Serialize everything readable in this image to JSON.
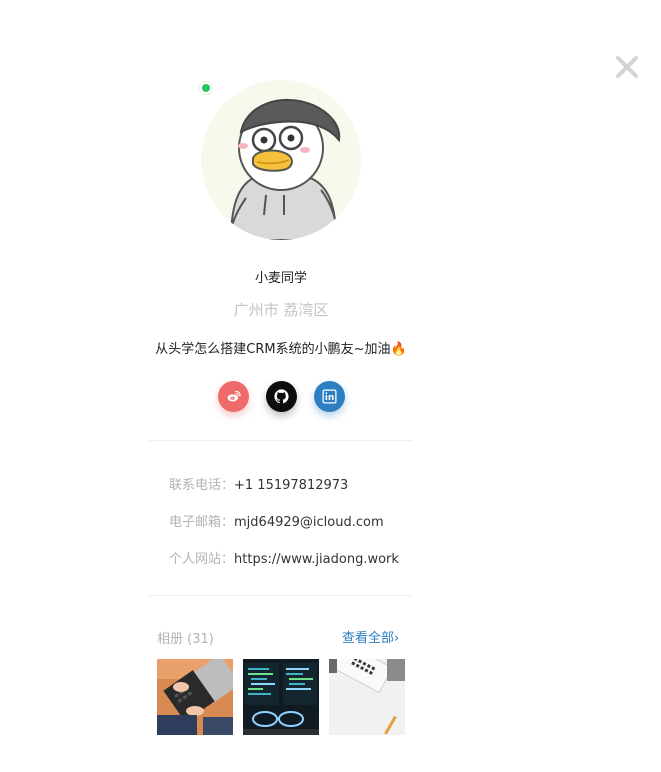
{
  "profile": {
    "name": "小麦同学",
    "location": "广州市 荔湾区",
    "bio": "从头学怎么搭建CRM系统的小鹏友~加油",
    "bio_emoji": "🔥",
    "online_status": "online",
    "avatar_icon": "duck-hoodie-avatar"
  },
  "socials": [
    {
      "name": "weibo",
      "icon": "weibo-icon",
      "color": "#ef6b6b"
    },
    {
      "name": "github",
      "icon": "github-icon",
      "color": "#0d0d0d"
    },
    {
      "name": "linkedin",
      "icon": "linkedin-icon",
      "color": "#2d7fc1"
    }
  ],
  "contact": {
    "phone_label": "联系电话：",
    "phone": "+1 15197812973",
    "email_label": "电子邮箱：",
    "email": "mjd64929@icloud.com",
    "website_label": "个人网站：",
    "website": "https://www.jiadong.work"
  },
  "album": {
    "title": "相册 (31)",
    "view_all": "查看全部",
    "photos": [
      {
        "icon": "laptop-keyboard-photo"
      },
      {
        "icon": "code-monitor-photo"
      },
      {
        "icon": "white-keyboard-photo"
      }
    ]
  },
  "colors": {
    "accent": "#2d7fc1",
    "online": "#22c55e",
    "muted_text": "#b3b3b3"
  }
}
